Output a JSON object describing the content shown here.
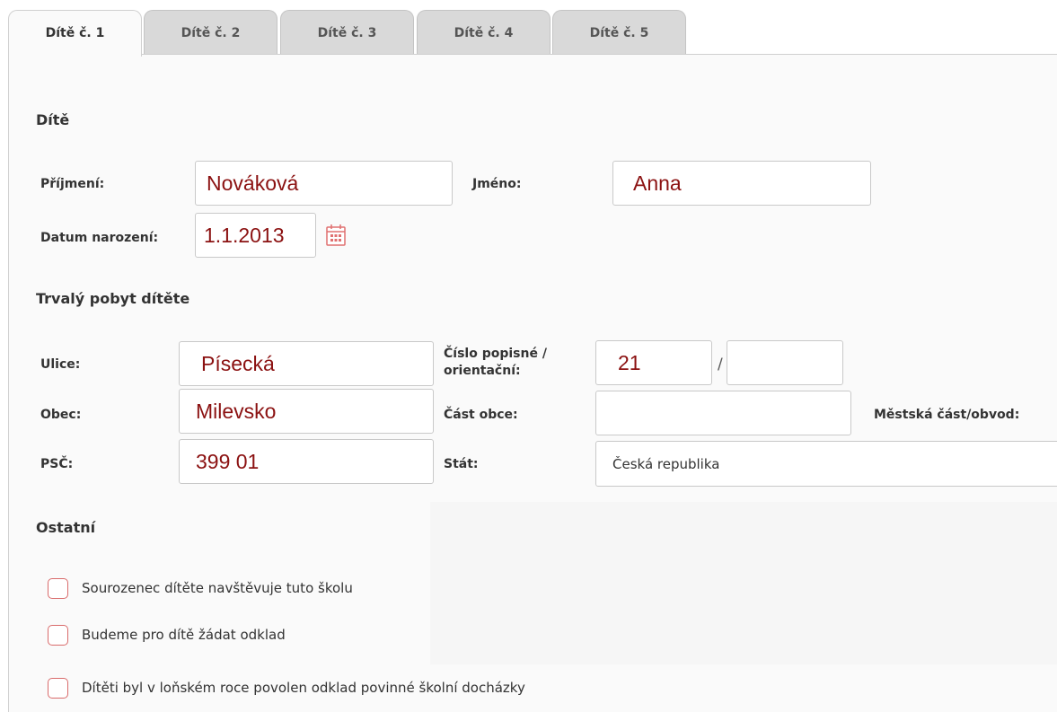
{
  "tabs": [
    {
      "label": "Dítě č. 1"
    },
    {
      "label": "Dítě č. 2"
    },
    {
      "label": "Dítě č. 3"
    },
    {
      "label": "Dítě č. 4"
    },
    {
      "label": "Dítě č. 5"
    }
  ],
  "sections": {
    "child": "Dítě",
    "residence": "Trvalý pobyt dítěte",
    "other": "Ostatní"
  },
  "child": {
    "surname_label": "Příjmení:",
    "surname_value": "Nováková",
    "name_label": "Jméno:",
    "name_value": "Anna",
    "birthdate_label": "Datum narození:",
    "birthdate_value": "1.1.2013"
  },
  "residence": {
    "street_label": "Ulice:",
    "street_value": "Písecká",
    "house_number_label_line1": "Číslo popisné /",
    "house_number_label_line2": "orientační:",
    "house_number_value": "21",
    "orientation_number_value": "",
    "separator": "/",
    "city_label": "Obec:",
    "city_value": "Milevsko",
    "city_part_label": "Část obce:",
    "city_part_value": "",
    "district_label": "Městská část/obvod:",
    "zip_label": "PSČ:",
    "zip_value": "399 01",
    "country_label": "Stát:",
    "country_value": "Česká republika"
  },
  "other": {
    "checkboxes": [
      {
        "label": "Sourozenec dítěte navštěvuje tuto školu",
        "checked": false
      },
      {
        "label": "Budeme pro dítě žádat odklad",
        "checked": false
      },
      {
        "label": "Dítěti byl v loňském roce povolen odklad povinné školní docházky",
        "checked": false
      }
    ]
  },
  "icons": {
    "calendar": "calendar-icon"
  },
  "colors": {
    "input_text": "#8b1111",
    "checkbox_border": "#d96b6b",
    "calendar": "#e07070"
  }
}
